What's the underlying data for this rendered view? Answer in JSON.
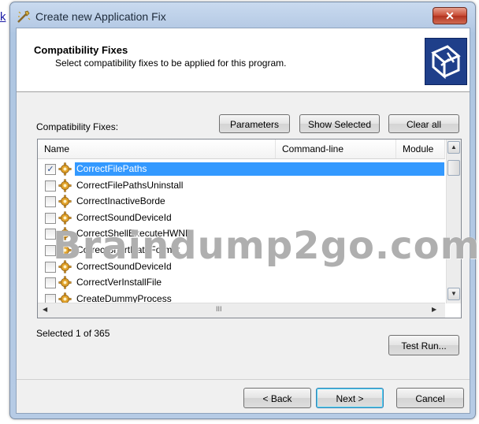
{
  "edge_text": "k",
  "window": {
    "title": "Create new Application Fix",
    "close_glyph": "✕"
  },
  "header": {
    "title": "Compatibility Fixes",
    "subtitle": "Select compatibility fixes to be applied for this program."
  },
  "toolbar": {
    "label": "Compatibility Fixes:",
    "parameters": "Parameters",
    "show_selected": "Show Selected",
    "clear_all": "Clear all"
  },
  "list": {
    "columns": [
      "Name",
      "Command-line",
      "Module"
    ],
    "items": [
      {
        "name": "CorrectFilePaths",
        "checked": true,
        "selected": true
      },
      {
        "name": "CorrectFilePathsUninstall",
        "checked": false,
        "selected": false
      },
      {
        "name": "CorrectInactiveBorde",
        "checked": false,
        "selected": false
      },
      {
        "name": "CorrectSoundDeviceId",
        "checked": false,
        "selected": false
      },
      {
        "name": "CorrectShellExecuteHWND",
        "checked": false,
        "selected": false
      },
      {
        "name": "CorrectShortDateFormat",
        "checked": false,
        "selected": false
      },
      {
        "name": "CorrectSoundDeviceId",
        "checked": false,
        "selected": false
      },
      {
        "name": "CorrectVerInstallFile",
        "checked": false,
        "selected": false
      },
      {
        "name": "CreateDummyProcess",
        "checked": false,
        "selected": false
      }
    ],
    "hscroll_grip": "III"
  },
  "status": {
    "selected_count": "Selected 1 of 365"
  },
  "buttons": {
    "test_run": "Test Run...",
    "back": "< Back",
    "next": "Next >",
    "cancel": "Cancel"
  },
  "watermark": "Braindump2go.com",
  "colors": {
    "selection": "#3399ff",
    "title_bar": "#c9daef",
    "close": "#c74a33"
  }
}
